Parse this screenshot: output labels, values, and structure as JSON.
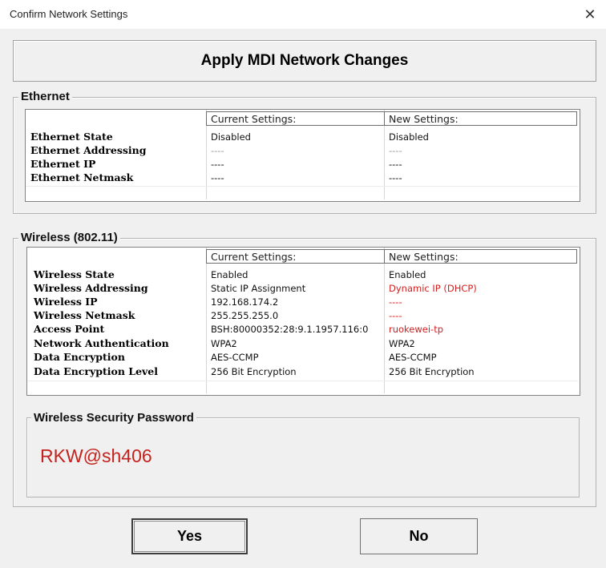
{
  "window": {
    "title": "Confirm Network Settings",
    "close_glyph": "✕"
  },
  "header": {
    "title": "Apply MDI Network Changes"
  },
  "columns": {
    "current": "Current Settings:",
    "new": "New Settings:"
  },
  "ethernet": {
    "label": "Ethernet",
    "rows": [
      {
        "label": "Ethernet State",
        "current": "Disabled",
        "new": "Disabled"
      },
      {
        "label": "Ethernet Addressing",
        "current": "----",
        "new": "----"
      },
      {
        "label": "Ethernet IP",
        "current": "----",
        "new": "----"
      },
      {
        "label": "Ethernet Netmask",
        "current": "----",
        "new": "----"
      }
    ]
  },
  "wireless": {
    "label": "Wireless (802.11)",
    "rows": [
      {
        "label": "Wireless State",
        "current": "Enabled",
        "new": "Enabled"
      },
      {
        "label": "Wireless Addressing",
        "current": "Static IP Assignment",
        "new": "Dynamic IP (DHCP)"
      },
      {
        "label": "Wireless IP",
        "current": "192.168.174.2",
        "new": "----"
      },
      {
        "label": "Wireless Netmask",
        "current": "255.255.255.0",
        "new": "----"
      },
      {
        "label": "Access Point",
        "current": "BSH:80000352:28:9.1.1957.116:0",
        "new": "ruokewei-tp"
      },
      {
        "label": "Network Authentication",
        "current": "WPA2",
        "new": "WPA2"
      },
      {
        "label": "Data Encryption",
        "current": "AES-CCMP",
        "new": "AES-CCMP"
      },
      {
        "label": "Data Encryption Level",
        "current": "256 Bit Encryption",
        "new": "256 Bit Encryption"
      }
    ]
  },
  "password": {
    "label": "Wireless Security Password",
    "value": "RKW@sh406"
  },
  "buttons": {
    "yes": "Yes",
    "no": "No"
  },
  "colors": {
    "changed_value": "#d32020",
    "password": "#c4221f"
  }
}
